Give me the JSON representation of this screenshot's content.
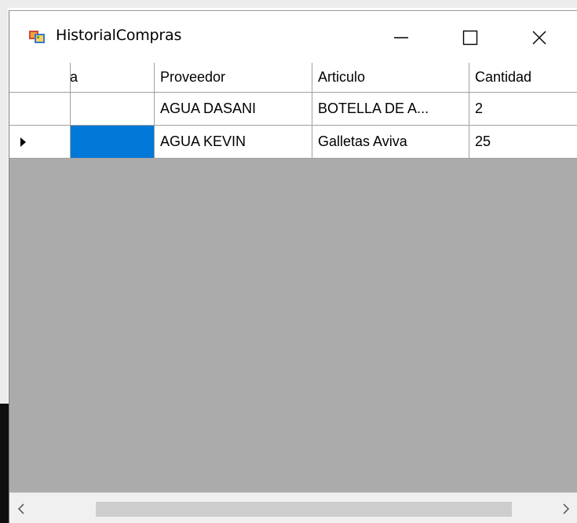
{
  "window": {
    "title": "HistorialCompras",
    "icon": "winforms-app-icon"
  },
  "titlebar_buttons": {
    "minimize": "minimize-icon",
    "maximize": "maximize-icon",
    "close": "close-icon"
  },
  "grid": {
    "columns": [
      "a",
      "Proveedor",
      "Articulo",
      "Cantidad"
    ],
    "rows": [
      {
        "current": false,
        "cells": [
          "",
          "AGUA DASANI",
          "BOTELLA DE A...",
          "2"
        ]
      },
      {
        "current": true,
        "cells": [
          "",
          "AGUA KEVIN",
          "Galletas Aviva",
          "25"
        ]
      }
    ],
    "selected_cell_color": "#0078d7",
    "empty_area_color": "#ababab"
  },
  "scrollbar": {
    "left_arrow": "‹",
    "right_arrow": "›"
  }
}
